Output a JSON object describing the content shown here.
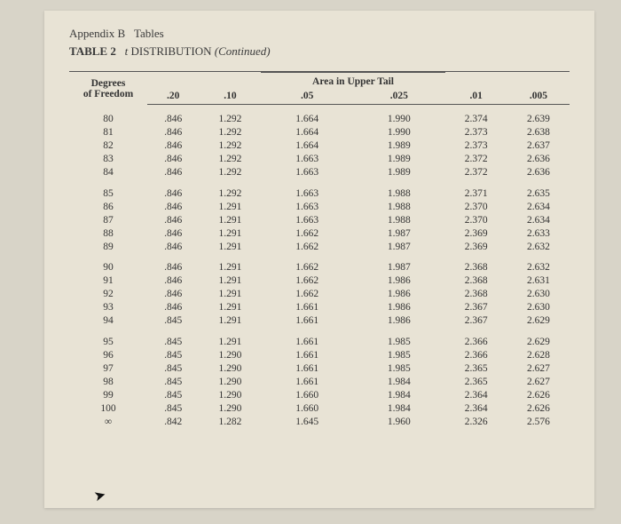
{
  "header": {
    "appendix": "Appendix B",
    "tables_word": "Tables",
    "table_label": "TABLE 2",
    "title_var": "t",
    "title_rest": "DISTRIBUTION",
    "continued": "(Continued)"
  },
  "columns": {
    "df_label_line1": "Degrees",
    "df_label_line2": "of Freedom",
    "area_label": "Area in Upper Tail",
    "alpha": [
      ".20",
      ".10",
      ".05",
      ".025",
      ".01",
      ".005"
    ]
  },
  "groups": [
    {
      "rows": [
        {
          "df": "80",
          "v": [
            ".846",
            "1.292",
            "1.664",
            "1.990",
            "2.374",
            "2.639"
          ]
        },
        {
          "df": "81",
          "v": [
            ".846",
            "1.292",
            "1.664",
            "1.990",
            "2.373",
            "2.638"
          ]
        },
        {
          "df": "82",
          "v": [
            ".846",
            "1.292",
            "1.664",
            "1.989",
            "2.373",
            "2.637"
          ]
        },
        {
          "df": "83",
          "v": [
            ".846",
            "1.292",
            "1.663",
            "1.989",
            "2.372",
            "2.636"
          ]
        },
        {
          "df": "84",
          "v": [
            ".846",
            "1.292",
            "1.663",
            "1.989",
            "2.372",
            "2.636"
          ]
        }
      ]
    },
    {
      "rows": [
        {
          "df": "85",
          "v": [
            ".846",
            "1.292",
            "1.663",
            "1.988",
            "2.371",
            "2.635"
          ]
        },
        {
          "df": "86",
          "v": [
            ".846",
            "1.291",
            "1.663",
            "1.988",
            "2.370",
            "2.634"
          ]
        },
        {
          "df": "87",
          "v": [
            ".846",
            "1.291",
            "1.663",
            "1.988",
            "2.370",
            "2.634"
          ]
        },
        {
          "df": "88",
          "v": [
            ".846",
            "1.291",
            "1.662",
            "1.987",
            "2.369",
            "2.633"
          ]
        },
        {
          "df": "89",
          "v": [
            ".846",
            "1.291",
            "1.662",
            "1.987",
            "2.369",
            "2.632"
          ]
        }
      ]
    },
    {
      "rows": [
        {
          "df": "90",
          "v": [
            ".846",
            "1.291",
            "1.662",
            "1.987",
            "2.368",
            "2.632"
          ]
        },
        {
          "df": "91",
          "v": [
            ".846",
            "1.291",
            "1.662",
            "1.986",
            "2.368",
            "2.631"
          ]
        },
        {
          "df": "92",
          "v": [
            ".846",
            "1.291",
            "1.662",
            "1.986",
            "2.368",
            "2.630"
          ]
        },
        {
          "df": "93",
          "v": [
            ".846",
            "1.291",
            "1.661",
            "1.986",
            "2.367",
            "2.630"
          ]
        },
        {
          "df": "94",
          "v": [
            ".845",
            "1.291",
            "1.661",
            "1.986",
            "2.367",
            "2.629"
          ]
        }
      ]
    },
    {
      "rows": [
        {
          "df": "95",
          "v": [
            ".845",
            "1.291",
            "1.661",
            "1.985",
            "2.366",
            "2.629"
          ]
        },
        {
          "df": "96",
          "v": [
            ".845",
            "1.290",
            "1.661",
            "1.985",
            "2.366",
            "2.628"
          ]
        },
        {
          "df": "97",
          "v": [
            ".845",
            "1.290",
            "1.661",
            "1.985",
            "2.365",
            "2.627"
          ]
        },
        {
          "df": "98",
          "v": [
            ".845",
            "1.290",
            "1.661",
            "1.984",
            "2.365",
            "2.627"
          ]
        },
        {
          "df": "99",
          "v": [
            ".845",
            "1.290",
            "1.660",
            "1.984",
            "2.364",
            "2.626"
          ]
        },
        {
          "df": "100",
          "v": [
            ".845",
            "1.290",
            "1.660",
            "1.984",
            "2.364",
            "2.626"
          ]
        },
        {
          "df": "∞",
          "v": [
            ".842",
            "1.282",
            "1.645",
            "1.960",
            "2.326",
            "2.576"
          ]
        }
      ]
    }
  ]
}
